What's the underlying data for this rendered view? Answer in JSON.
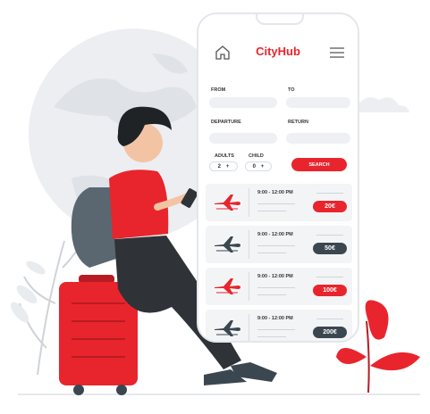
{
  "app": {
    "title": "CityHub"
  },
  "form": {
    "from_label": "FROM",
    "to_label": "TO",
    "departure_label": "DEPARTURE",
    "return_label": "RETURN",
    "adults_label": "ADULTS",
    "child_label": "CHILD",
    "adults_value": "2",
    "child_value": "0",
    "plus": "+",
    "search_label": "SEARCH"
  },
  "flights": [
    {
      "time": "9:00 - 12:00 PM",
      "price": "20€",
      "price_color": "#e8252d",
      "plane_color": "#e8252d"
    },
    {
      "time": "9:00 - 12:00 PM",
      "price": "50€",
      "price_color": "#3b4750",
      "plane_color": "#3b4750"
    },
    {
      "time": "9:00 - 12:00 PM",
      "price": "100€",
      "price_color": "#e8252d",
      "plane_color": "#e8252d"
    },
    {
      "time": "9:00 - 12:00 PM",
      "price": "200€",
      "price_color": "#3b4750",
      "plane_color": "#3b4750"
    }
  ],
  "colors": {
    "accent": "#e8252d",
    "dark": "#3b4750",
    "globe": "#eceef1"
  },
  "icons": [
    "home-icon",
    "menu-icon",
    "airplane-icon",
    "globe",
    "suitcase",
    "backpack",
    "plant"
  ]
}
